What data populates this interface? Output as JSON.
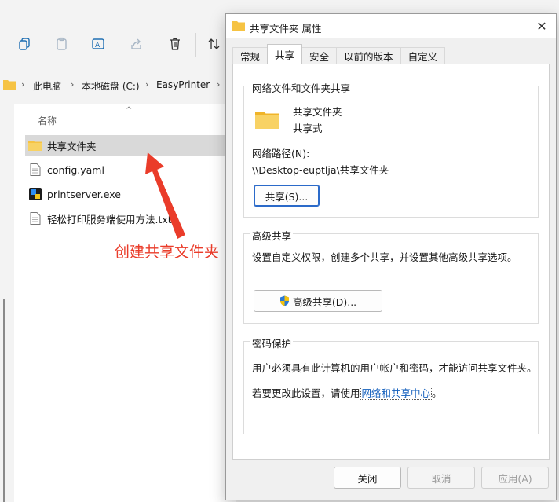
{
  "explorer": {
    "breadcrumb": [
      "此电脑",
      "本地磁盘 (C:)",
      "EasyPrinter"
    ],
    "column_header": "名称",
    "files": [
      {
        "name": "共享文件夹",
        "type": "folder",
        "selected": true
      },
      {
        "name": "config.yaml",
        "type": "file"
      },
      {
        "name": "printserver.exe",
        "type": "exe"
      },
      {
        "name": "轻松打印服务端使用方法.txt",
        "type": "file"
      }
    ],
    "annotation": "创建共享文件夹",
    "toolbar_icons": [
      "copy-icon",
      "paste-icon",
      "rename-icon",
      "share-icon",
      "delete-icon",
      "sort-icon"
    ]
  },
  "dialog": {
    "title": "共享文件夹 属性",
    "tabs": [
      "常规",
      "共享",
      "安全",
      "以前的版本",
      "自定义"
    ],
    "active_tab": "共享",
    "network_sharing": {
      "group_label": "网络文件和文件夹共享",
      "folder_name": "共享文件夹",
      "share_state": "共享式",
      "path_label": "网络路径(N):",
      "path_value": "\\\\Desktop-euptlja\\共享文件夹",
      "share_button": "共享(S)..."
    },
    "advanced_sharing": {
      "group_label": "高级共享",
      "description": "设置自定义权限，创建多个共享，并设置其他高级共享选项。",
      "button": "高级共享(D)..."
    },
    "password_protection": {
      "group_label": "密码保护",
      "description": "用户必须具有此计算机的用户帐户和密码，才能访问共享文件夹。",
      "change_prefix": "若要更改此设置，请使用",
      "link": "网络和共享中心",
      "change_suffix": "。"
    },
    "buttons": {
      "close": "关闭",
      "cancel": "取消",
      "apply": "应用(A)"
    }
  },
  "colors": {
    "annotation": "#ea3c2a",
    "link": "#1560bd",
    "folder": "#f6c343",
    "focus": "#2b6ac9"
  }
}
